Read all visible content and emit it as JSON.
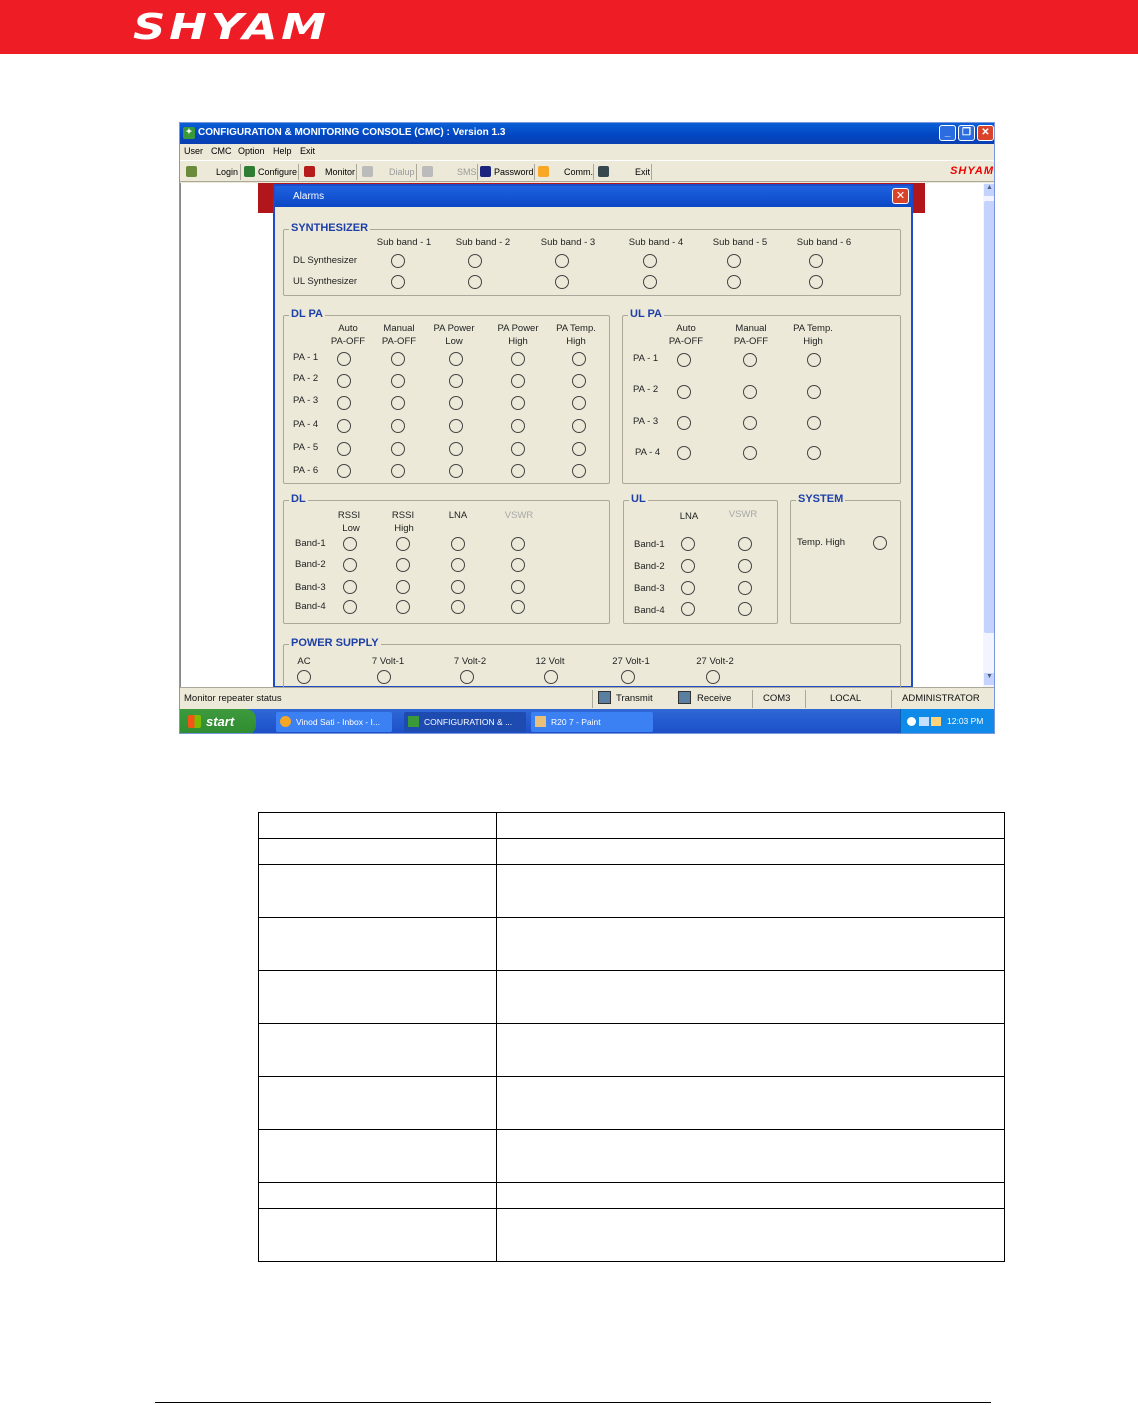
{
  "header": {
    "logo": "SHYAM"
  },
  "window": {
    "title": "CONFIGURATION & MONITORING CONSOLE (CMC)  :  Version 1.3",
    "controls": [
      "minimize",
      "restore",
      "close"
    ]
  },
  "menu": [
    "User",
    "CMC",
    "Option",
    "Help",
    "Exit"
  ],
  "toolbar": {
    "items": [
      {
        "label": "Login",
        "enabled": true
      },
      {
        "label": "Configure",
        "enabled": true
      },
      {
        "label": "Monitor",
        "enabled": true
      },
      {
        "label": "Dialup",
        "enabled": false
      },
      {
        "label": "SMS",
        "enabled": false
      },
      {
        "label": "Password",
        "enabled": true
      },
      {
        "label": "Comm.",
        "enabled": true
      },
      {
        "label": "Exit",
        "enabled": true
      }
    ],
    "logo": "SHYAM"
  },
  "dialog": {
    "title": "Alarms",
    "synthesizer": {
      "title": "SYNTHESIZER",
      "columns": [
        "Sub band - 1",
        "Sub band - 2",
        "Sub band - 3",
        "Sub band - 4",
        "Sub band - 5",
        "Sub band - 6"
      ],
      "rows": [
        "DL Synthesizer",
        "UL Synthesizer"
      ]
    },
    "dl_pa": {
      "title": "DL PA",
      "columns": [
        [
          "Auto",
          "PA-OFF"
        ],
        [
          "Manual",
          "PA-OFF"
        ],
        [
          "PA Power",
          "Low"
        ],
        [
          "PA Power",
          "High"
        ],
        [
          "PA Temp.",
          "High"
        ]
      ],
      "rows": [
        "PA - 1",
        "PA - 2",
        "PA - 3",
        "PA - 4",
        "PA - 5",
        "PA - 6"
      ]
    },
    "ul_pa": {
      "title": "UL PA",
      "columns": [
        [
          "Auto",
          "PA-OFF"
        ],
        [
          "Manual",
          "PA-OFF"
        ],
        [
          "PA Temp.",
          "High"
        ]
      ],
      "rows": [
        "PA - 1",
        "PA - 2",
        "PA - 3",
        "PA - 4"
      ]
    },
    "dl": {
      "title": "DL",
      "columns": [
        [
          "RSSI",
          "Low"
        ],
        [
          "RSSI",
          "High"
        ],
        [
          "LNA",
          ""
        ],
        [
          "VSWR",
          ""
        ]
      ],
      "disabled_columns": [
        "VSWR"
      ],
      "rows": [
        "Band-1",
        "Band-2",
        "Band-3",
        "Band-4"
      ]
    },
    "ul": {
      "title": "UL",
      "columns": [
        "LNA",
        "VSWR"
      ],
      "disabled_columns": [
        "VSWR"
      ],
      "rows": [
        "Band-1",
        "Band-2",
        "Band-3",
        "Band-4"
      ]
    },
    "system": {
      "title": "SYSTEM",
      "items": [
        "Temp. High"
      ]
    },
    "power_supply": {
      "title": "POWER SUPPLY",
      "items": [
        "AC",
        "7 Volt-1",
        "7 Volt-2",
        "12 Volt",
        "27 Volt-1",
        "27 Volt-2"
      ]
    }
  },
  "statusbar": {
    "message": "Monitor repeater status",
    "transmit": "Transmit",
    "receive": "Receive",
    "port": "COM3",
    "mode": "LOCAL",
    "user": "ADMINISTRATOR"
  },
  "taskbar": {
    "start": "start",
    "tasks": [
      {
        "label": "Vinod Sati - Inbox - I..."
      },
      {
        "label": "CONFIGURATION & ..."
      },
      {
        "label": "R20 7 - Paint"
      }
    ],
    "clock": "12:03 PM"
  },
  "doc_table": {
    "row_count": 11
  }
}
